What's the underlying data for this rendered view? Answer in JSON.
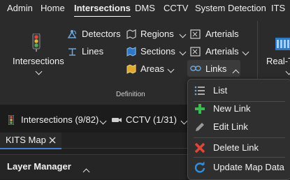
{
  "menubar": {
    "tabs": [
      {
        "label": "Admin"
      },
      {
        "label": "Home"
      },
      {
        "label": "Intersections"
      },
      {
        "label": "DMS"
      },
      {
        "label": "CCTV"
      },
      {
        "label": "System Detection"
      },
      {
        "label": "ITS"
      }
    ]
  },
  "ribbon": {
    "intersections_label": "Intersections",
    "detectors_label": "Detectors",
    "lines_label": "Lines",
    "regions_label": "Regions",
    "sections_label": "Sections",
    "areas_label": "Areas",
    "arterials_label": "Arterials",
    "arterials_dropdown_label": "Arterials",
    "links_label": "Links",
    "realtime_label": "Real-T",
    "group_definition": "Definition"
  },
  "statusbar": {
    "intersections_filter": "Intersections (9/82)",
    "cctv_filter": "CCTV (1/31)"
  },
  "doc_tabs": {
    "kits_map": "KITS Map"
  },
  "layer_manager": {
    "title": "Layer Manager"
  },
  "links_menu": {
    "items": [
      {
        "label": "List",
        "icon": "list-icon"
      },
      {
        "label": "New Link",
        "icon": "plus-icon"
      },
      {
        "label": "Edit Link",
        "icon": "pencil-icon"
      },
      {
        "label": "Delete Link",
        "icon": "delete-x-icon"
      },
      {
        "label": "Update Map Data",
        "icon": "refresh-icon"
      }
    ]
  },
  "colors": {
    "accent_tab_underline": "#3f7fd6",
    "plus_green": "#3fb950",
    "delete_red": "#e0453a",
    "refresh_blue": "#2f8fe0"
  }
}
